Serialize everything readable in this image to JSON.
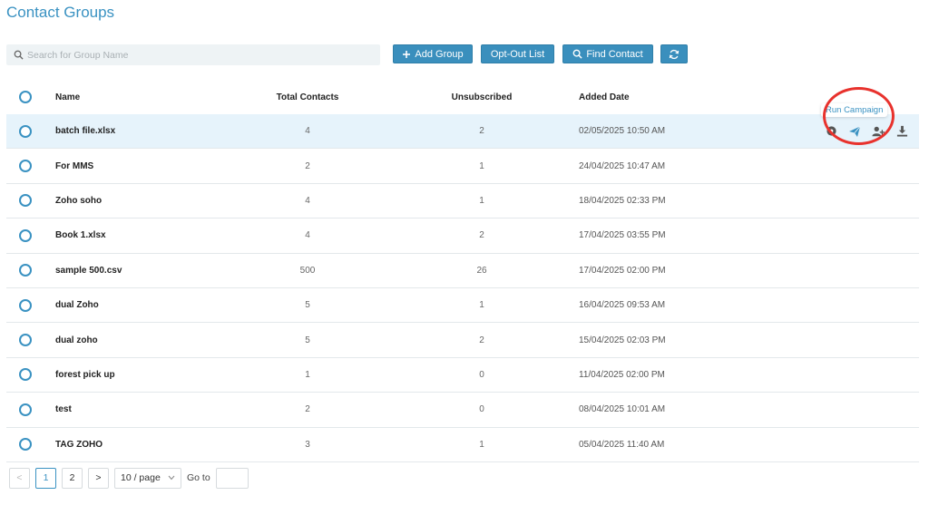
{
  "page": {
    "title": "Contact Groups"
  },
  "search": {
    "placeholder": "Search for Group Name"
  },
  "toolbar": {
    "add_group": "Add Group",
    "opt_out": "Opt-Out List",
    "find_contact": "Find Contact"
  },
  "table": {
    "headers": {
      "name": "Name",
      "total": "Total Contacts",
      "unsub": "Unsubscribed",
      "date": "Added Date"
    },
    "rows": [
      {
        "name": "batch file.xlsx",
        "total": "4",
        "unsub": "2",
        "date": "02/05/2025 10:50 AM"
      },
      {
        "name": "For MMS",
        "total": "2",
        "unsub": "1",
        "date": "24/04/2025 10:47 AM"
      },
      {
        "name": "Zoho soho",
        "total": "4",
        "unsub": "1",
        "date": "18/04/2025 02:33 PM"
      },
      {
        "name": "Book 1.xlsx",
        "total": "4",
        "unsub": "2",
        "date": "17/04/2025 03:55 PM"
      },
      {
        "name": "sample 500.csv",
        "total": "500",
        "unsub": "26",
        "date": "17/04/2025 02:00 PM"
      },
      {
        "name": "dual Zoho",
        "total": "5",
        "unsub": "1",
        "date": "16/04/2025 09:53 AM"
      },
      {
        "name": "dual zoho",
        "total": "5",
        "unsub": "2",
        "date": "15/04/2025 02:03 PM"
      },
      {
        "name": "forest pick up",
        "total": "1",
        "unsub": "0",
        "date": "11/04/2025 02:00 PM"
      },
      {
        "name": "test",
        "total": "2",
        "unsub": "0",
        "date": "08/04/2025 10:01 AM"
      },
      {
        "name": "TAG ZOHO",
        "total": "3",
        "unsub": "1",
        "date": "05/04/2025 11:40 AM"
      }
    ],
    "row_actions": [
      "view-icon",
      "send-icon",
      "add-user-icon",
      "download-icon"
    ]
  },
  "tooltip": {
    "text": "Run Campaign"
  },
  "pagination": {
    "prev": "<",
    "pages": [
      "1",
      "2"
    ],
    "next": ">",
    "page_size": "10 / page",
    "goto_label": "Go to"
  },
  "colors": {
    "accent": "#3a92c2",
    "button": "#3a8fbd",
    "highlight": "#e8322d",
    "row_selected": "#e6f3fb"
  }
}
